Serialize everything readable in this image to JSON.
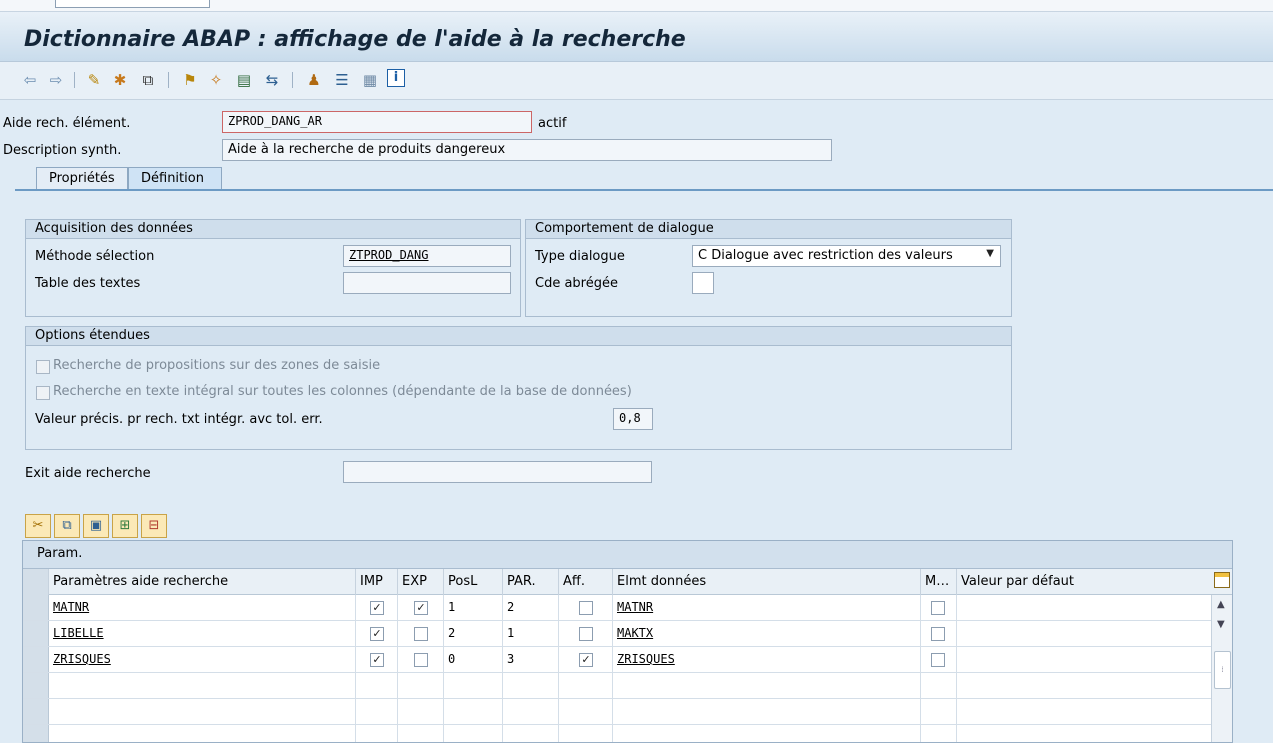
{
  "window": {
    "title": "Dictionnaire ABAP : affichage de l'aide à la recherche"
  },
  "toolbar": {
    "icons": [
      "back-arrow-icon",
      "forward-arrow-icon",
      "display-change-icon",
      "activate-icon",
      "other-object-icon",
      "where-used-icon",
      "object-list-icon",
      "display-object-list-icon",
      "navigation-icon",
      "hierarchy-icon",
      "documentation-icon",
      "table-view-icon",
      "info-icon"
    ]
  },
  "header": {
    "search_help_label": "Aide rech. élément.",
    "search_help_value": "ZPROD_DANG_AR",
    "status": "actif",
    "short_desc_label": "Description synth.",
    "short_desc_value": "Aide à la recherche de produits dangereux"
  },
  "tabs": [
    {
      "label": "Propriétés",
      "active": false
    },
    {
      "label": "Définition",
      "active": true
    }
  ],
  "data_collection": {
    "title": "Acquisition des données",
    "selection_method_label": "Méthode sélection",
    "selection_method_value": "ZTPROD_DANG",
    "text_table_label": "Table des textes",
    "text_table_value": ""
  },
  "dialog_behavior": {
    "title": "Comportement de dialogue",
    "dialog_type_label": "Type dialogue",
    "dialog_type_value": "C Dialogue avec restriction des valeurs",
    "hot_key_label": "Cde abrégée",
    "hot_key_value": ""
  },
  "extended_options": {
    "title": "Options étendues",
    "proposal_search_label": "Recherche de propositions sur des zones de saisie",
    "fulltext_search_label": "Recherche en texte intégral sur toutes les colonnes (dépendante de la base de données)",
    "accuracy_label": "Valeur précis. pr rech. txt intégr. avc tol. err.",
    "accuracy_value": "0,8"
  },
  "exit": {
    "label": "Exit aide recherche",
    "value": ""
  },
  "params_table": {
    "title": "Param.",
    "columns": [
      "Paramètres aide recherche",
      "IMP",
      "EXP",
      "PosL",
      "PAR.",
      "Aff.",
      "Elmt données",
      "M…",
      "Valeur par défaut"
    ],
    "rows": [
      {
        "param": "MATNR",
        "imp": true,
        "exp": true,
        "posl": "1",
        "par": "2",
        "aff": false,
        "elmt": "MATNR",
        "m": false,
        "default": ""
      },
      {
        "param": "LIBELLE",
        "imp": true,
        "exp": false,
        "posl": "2",
        "par": "1",
        "aff": false,
        "elmt": "MAKTX",
        "m": false,
        "default": ""
      },
      {
        "param": "ZRISQUES",
        "imp": true,
        "exp": false,
        "posl": "0",
        "par": "3",
        "aff": true,
        "elmt": "ZRISQUES",
        "m": false,
        "default": ""
      }
    ],
    "empty_rows": 3
  },
  "colors": {
    "background": "#dfebf5",
    "title_text": "#14273a",
    "active_tab": "#cfe3f5",
    "required_marker": "#d9534f"
  }
}
